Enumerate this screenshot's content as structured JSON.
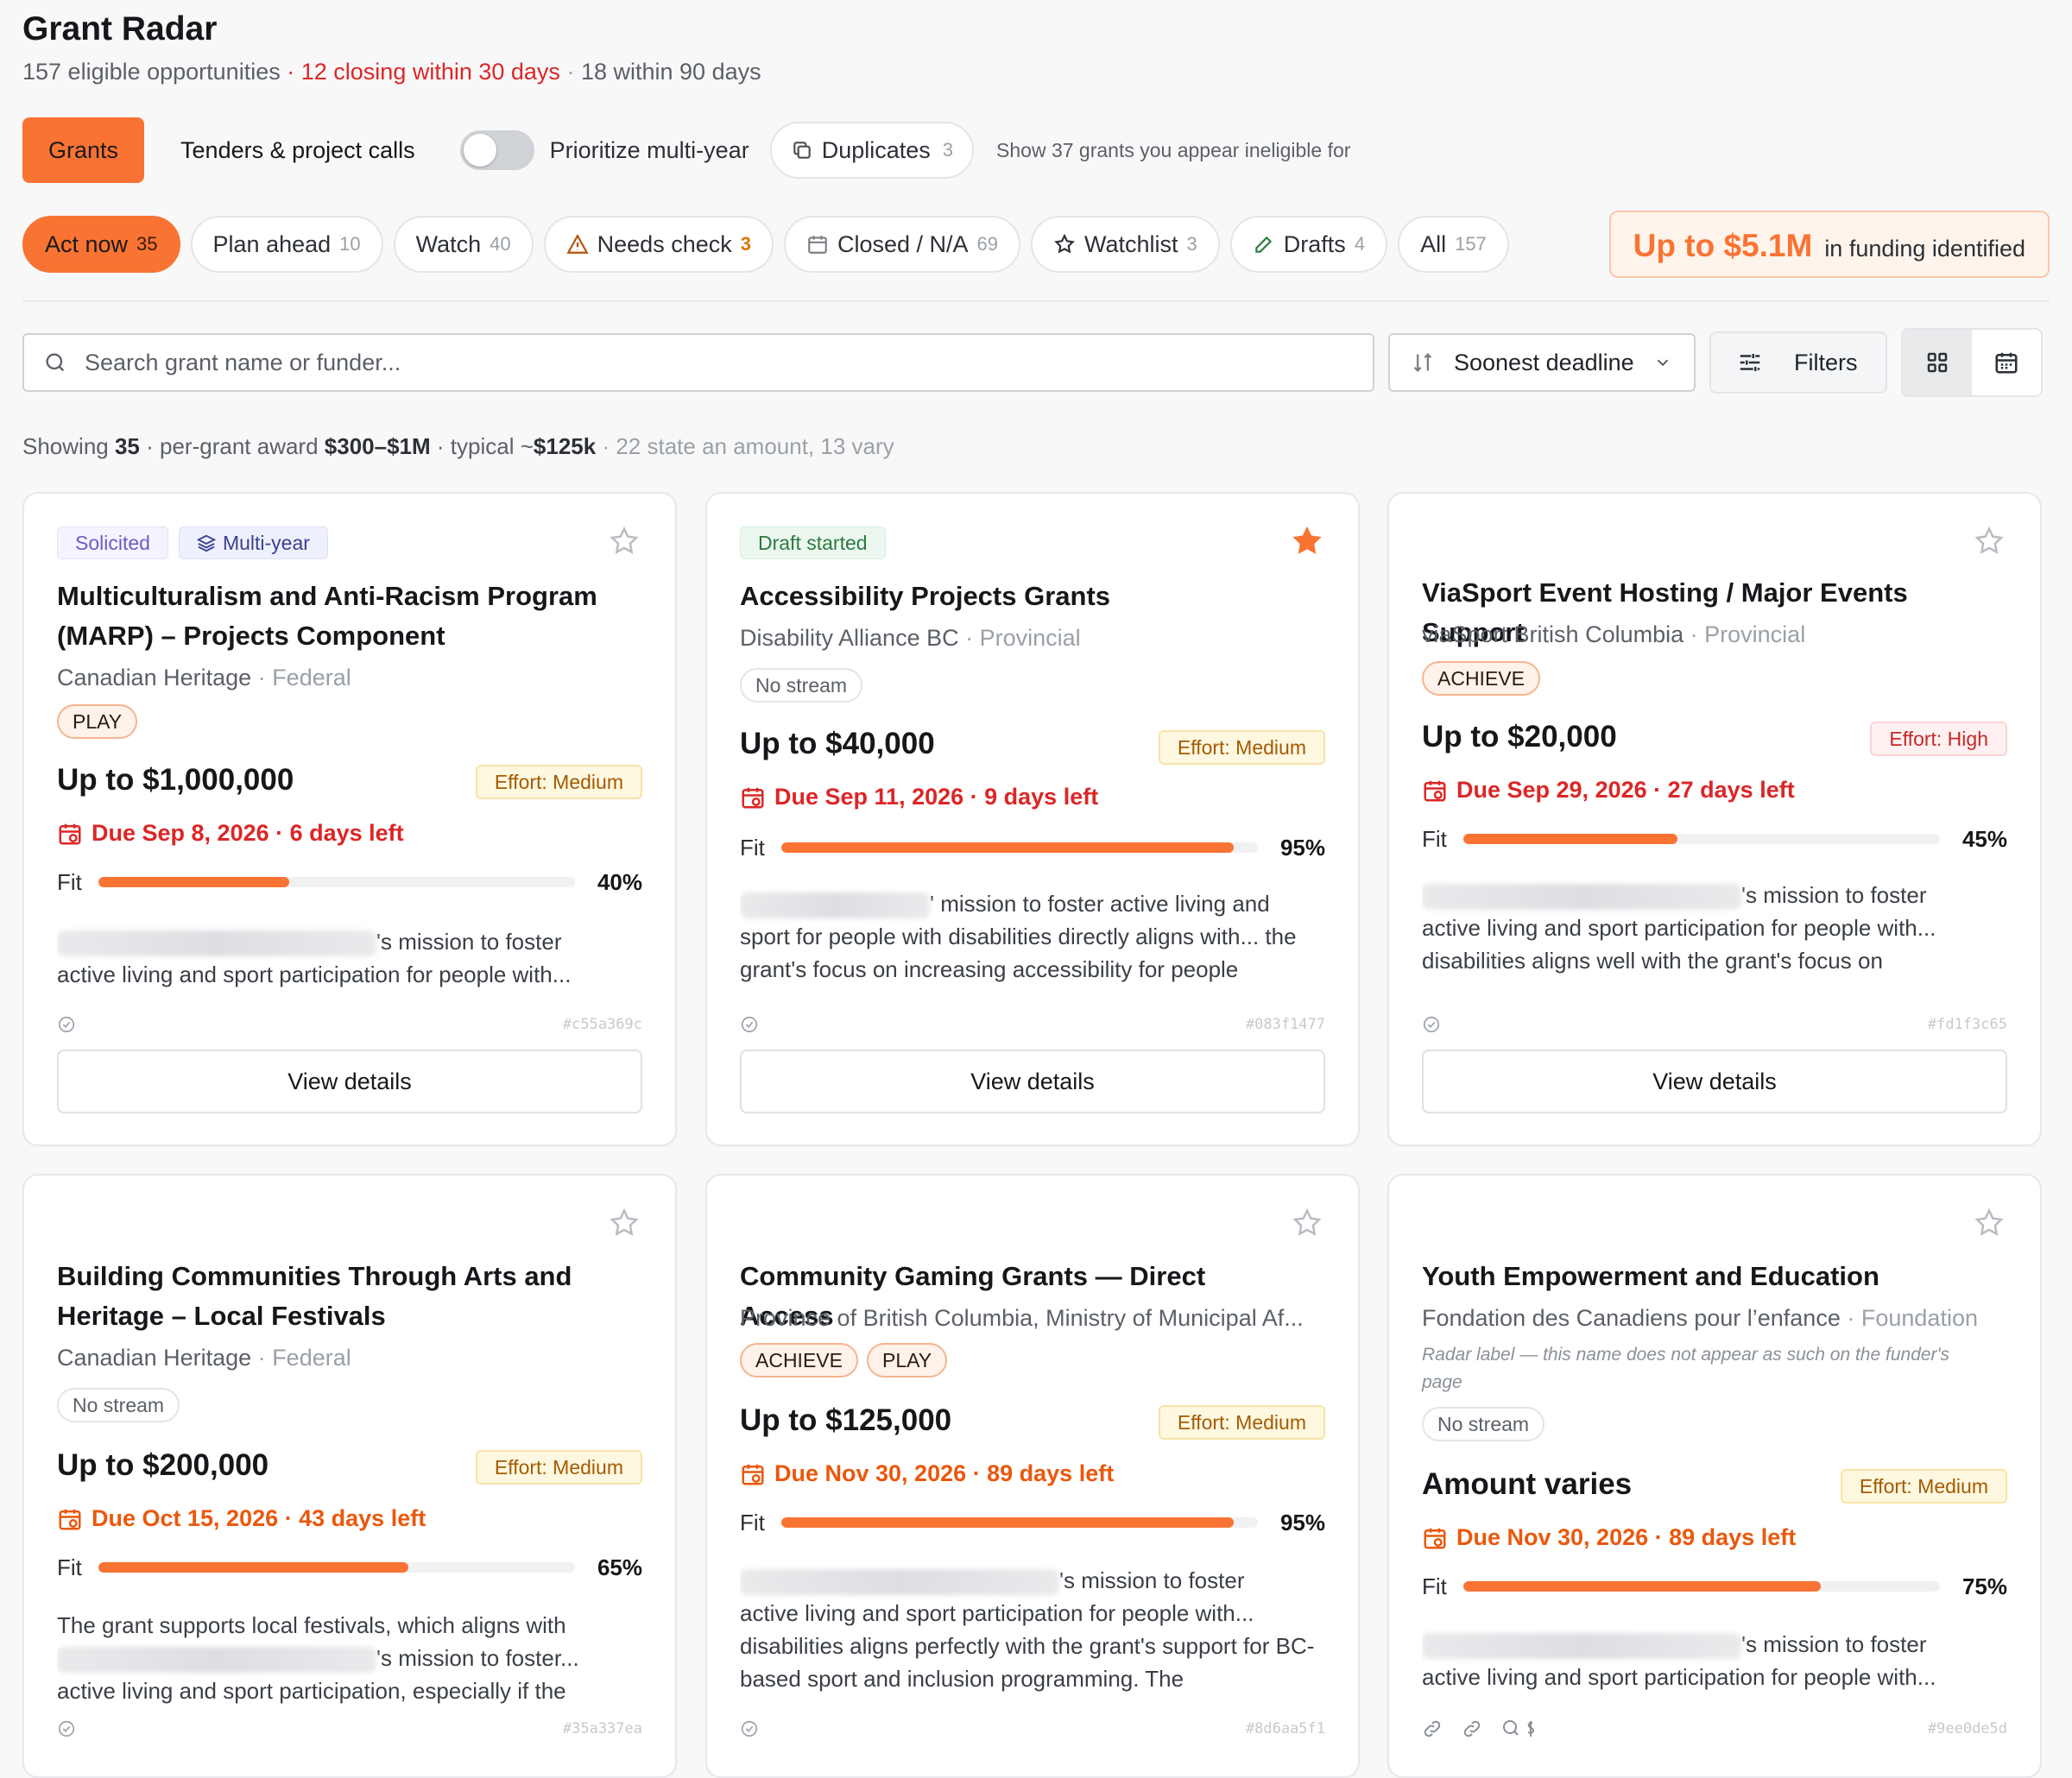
{
  "header": {
    "title": "Grant Radar",
    "eligible": "157 eligible opportunities",
    "closing": "12 closing within 30 days",
    "within90": "18 within 90 days",
    "sep": "·"
  },
  "tabs": {
    "grants": "Grants",
    "tenders": "Tenders & project calls",
    "toggle_label": "Prioritize multi-year",
    "toggle_on": false,
    "duplicates_label": "Duplicates",
    "duplicates_count": "3",
    "ineligible_link": "Show 37 grants you appear ineligible for"
  },
  "filters": [
    {
      "label": "Act now",
      "count": "35"
    },
    {
      "label": "Plan ahead",
      "count": "10"
    },
    {
      "label": "Watch",
      "count": "40"
    },
    {
      "label": "Needs check",
      "count": "3"
    },
    {
      "label": "Closed / N/A",
      "count": "69"
    },
    {
      "label": "Watchlist",
      "count": "3"
    },
    {
      "label": "Drafts",
      "count": "4"
    },
    {
      "label": "All",
      "count": "157"
    }
  ],
  "funding": {
    "amount": "Up to $5.1M",
    "label": "in funding identified"
  },
  "search": {
    "placeholder": "Search grant name or funder..."
  },
  "sort": {
    "label": "Soonest deadline"
  },
  "filters_button": "Filters",
  "showing": {
    "prefix": "Showing",
    "count": "35",
    "award_label": "· per-grant award",
    "award_range": "$300–$1M",
    "typical_label": "· typical ~",
    "typical": "$125k",
    "note": "· 22 state an amount, 13 vary"
  },
  "colors": {
    "accent": "#f97333",
    "urgent": "#dc2626",
    "due_orange": "#ea580c"
  },
  "cards": [
    {
      "tags": [
        "Solicited",
        "Multi-year"
      ],
      "starred": false,
      "title": "Multiculturalism and Anti-Racism Program (MARP) – Projects Component",
      "funder": "Canadian Heritage",
      "level": "Federal",
      "streams": [
        "PLAY"
      ],
      "amount": "Up to $1,000,000",
      "effort": "Effort: Medium",
      "due": "Due Sep 8, 2026 · 6 days left",
      "fit": 40,
      "fit_label": "40%",
      "desc_tail": "'s mission to foster",
      "desc_rest": "active living and sport participation for people with...",
      "hash": "#c55a369c",
      "button": "View details"
    },
    {
      "tags": [
        "Draft started"
      ],
      "starred": true,
      "title": "Accessibility Projects Grants",
      "funder": "Disability Alliance BC",
      "level": "Provincial",
      "streams": [
        "No stream"
      ],
      "amount": "Up to $40,000",
      "effort": "Effort: Medium",
      "due": "Due Sep 11, 2026 · 9 days left",
      "fit": 95,
      "fit_label": "95%",
      "desc_tail": "' mission to foster active living and",
      "desc_rest": "sport for people with disabilities directly aligns with... the grant's focus on increasing accessibility for people",
      "hash": "#083f1477",
      "button": "View details"
    },
    {
      "tags": [],
      "starred": false,
      "title": "ViaSport Event Hosting / Major Events Support",
      "funder": "viaSport British Columbia",
      "level": "Provincial",
      "streams": [
        "ACHIEVE"
      ],
      "amount": "Up to $20,000",
      "effort": "Effort: High",
      "due": "Due Sep 29, 2026 · 27 days left",
      "fit": 45,
      "fit_label": "45%",
      "desc_tail": "'s mission to foster",
      "desc_rest": "active living and sport participation for people with... disabilities aligns well with the grant's focus on",
      "hash": "#fd1f3c65",
      "button": "View details"
    },
    {
      "tags": [],
      "starred": false,
      "title": "Building Communities Through Arts and Heritage – Local Festivals",
      "funder": "Canadian Heritage",
      "level": "Federal",
      "streams": [
        "No stream"
      ],
      "amount": "Up to $200,000",
      "effort": "Effort: Medium",
      "due": "Due Oct 15, 2026 · 43 days left",
      "fit": 65,
      "fit_label": "65%",
      "desc_lead": "The grant supports local festivals, which aligns with",
      "desc_tail": "'s mission to foster...",
      "desc_rest": "active living and sport participation, especially if the",
      "hash": "#35a337ea"
    },
    {
      "tags": [],
      "starred": false,
      "title": "Community Gaming Grants — Direct Access",
      "funder": "Province of British Columbia, Ministry of Municipal Af...",
      "level": "",
      "streams": [
        "ACHIEVE",
        "PLAY"
      ],
      "amount": "Up to $125,000",
      "effort": "Effort: Medium",
      "due": "Due Nov 30, 2026 · 89 days left",
      "fit": 95,
      "fit_label": "95%",
      "desc_tail": "'s mission to foster",
      "desc_rest": "active living and sport participation for people with... disabilities aligns perfectly with the grant's support for BC-based sport and inclusion programming. The",
      "hash": "#8d6aa5f1"
    },
    {
      "tags": [],
      "starred": false,
      "title": "Youth Empowerment and Education",
      "funder": "Fondation des Canadiens pour l’enfance",
      "level": "Foundation",
      "radar_note": "Radar label — this name does not appear as such on the funder's page",
      "streams": [
        "No stream"
      ],
      "amount": "Amount varies",
      "effort": "Effort: Medium",
      "due": "Due Nov 30, 2026 · 89 days left",
      "fit": 75,
      "fit_label": "75%",
      "desc_tail": "'s mission to foster",
      "desc_rest": "active living and sport participation for people with...",
      "hash": "#9ee0de5d"
    }
  ]
}
